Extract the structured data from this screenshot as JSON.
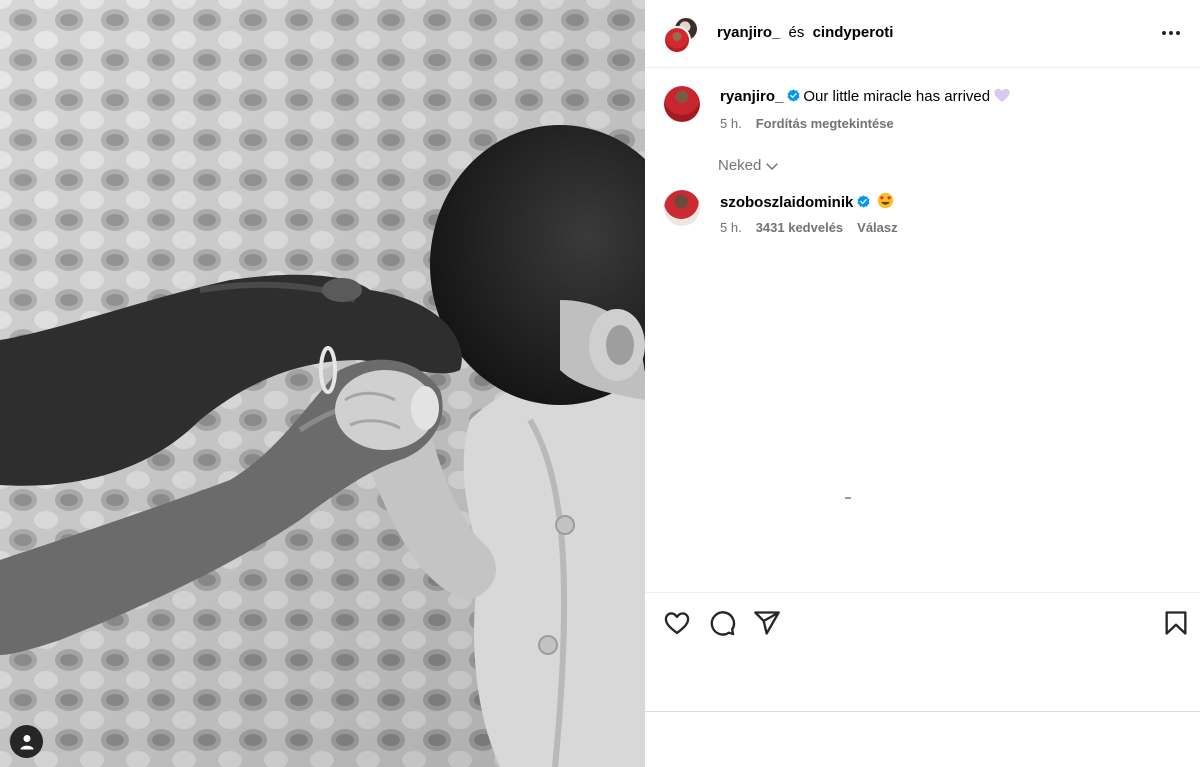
{
  "post": {
    "header": {
      "user1": "ryanjiro_",
      "conjunction": "és",
      "user2": "cindyperoti"
    },
    "caption": {
      "username": "ryanjiro_",
      "verified": true,
      "text": "Our little miracle has arrived",
      "emoji_icon": "light-purple-heart-icon",
      "time": "5 h.",
      "translate_label": "Fordítás megtekintése"
    },
    "sort_label": "Neked",
    "comments": [
      {
        "username": "szoboszlaidominik",
        "verified": true,
        "emoji_icon": "heart-eyes-emoji-icon",
        "time": "5 h.",
        "likes": "3431 kedvelés",
        "reply_label": "Válasz"
      }
    ],
    "actions": [
      "heart-icon",
      "comment-icon",
      "share-icon",
      "bookmark-icon"
    ],
    "photo_tag_icon": "person-tag-icon"
  },
  "colors": {
    "verified": "#0095f6",
    "secondary_text": "#737373",
    "divider": "#efefef"
  }
}
